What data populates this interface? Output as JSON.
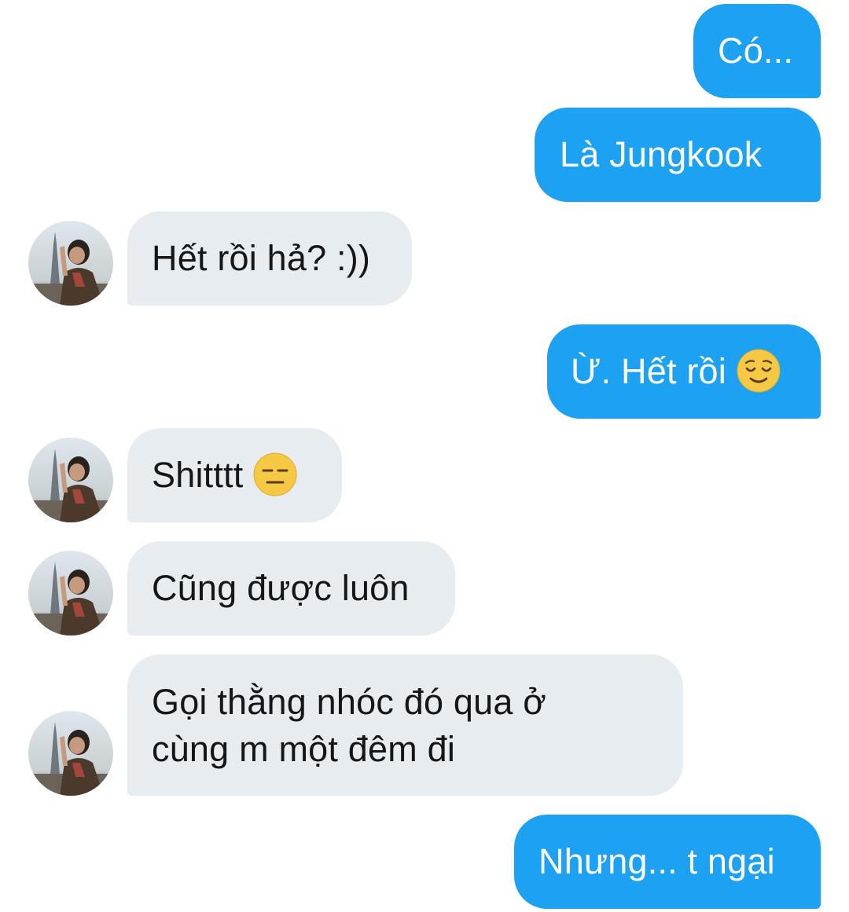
{
  "conversation": {
    "messages": [
      {
        "sender": "me",
        "text": "Có..."
      },
      {
        "sender": "me",
        "text": "Là Jungkook"
      },
      {
        "sender": "them",
        "text": "Hết rồi hả? :))"
      },
      {
        "sender": "me",
        "text": "Ừ. Hết rồi",
        "emoji": "relieved-face"
      },
      {
        "sender": "them",
        "text": "Shitttt",
        "emoji": "expressionless-face"
      },
      {
        "sender": "them",
        "text": "Cũng được luôn"
      },
      {
        "sender": "them",
        "lines": [
          "Gọi thằng nhóc đó qua ở",
          "cùng m một đêm đi"
        ]
      },
      {
        "sender": "me",
        "text": "Nhưng... t ngại"
      }
    ]
  },
  "colors": {
    "sent_bubble": "#1da1f2",
    "received_bubble": "#e6ecf0",
    "sent_text": "#ffffff",
    "received_text": "#14171a"
  },
  "icons": {
    "avatar": "user-avatar-photo",
    "emoji_1": "relieved-face",
    "emoji_2": "expressionless-face"
  }
}
